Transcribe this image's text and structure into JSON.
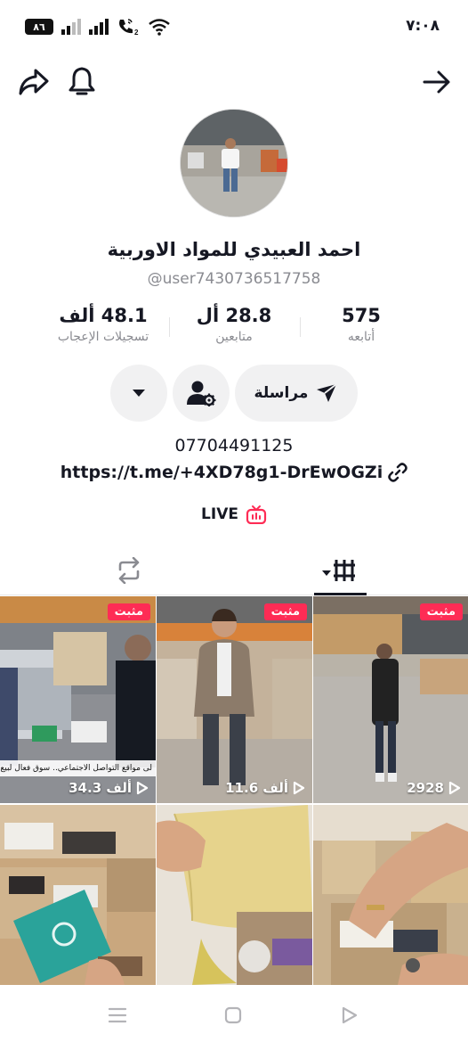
{
  "status_bar": {
    "battery": "٨٦",
    "time": "٧:٠٨",
    "sim_badge": "2"
  },
  "nav": {
    "share_icon": "share-icon",
    "bell_icon": "bell-icon",
    "back_icon": "arrow-right-icon"
  },
  "profile": {
    "display_name": "احمد العبيدي للمواد الاوربية",
    "username": "@user7430736517758",
    "phone": "07704491125",
    "link": "https://t.me/+4XD78g1-DrEwOGZi",
    "live_label": "LIVE"
  },
  "stats": [
    {
      "value": "575",
      "label": "أتابعه"
    },
    {
      "value": "28.8 أل",
      "label": "متابعين"
    },
    {
      "value": "48.1 ألف",
      "label": "تسجيلات الإعجاب"
    }
  ],
  "buttons": {
    "message_label": "مراسلة"
  },
  "videos": [
    {
      "pinned": "مثبت",
      "views": "34.3 ألف",
      "caption": "لى مواقع التواصل الاجتماعي.. سوق فعال لبيع البضائع ال"
    },
    {
      "pinned": "مثبت",
      "views": "11.6 ألف"
    },
    {
      "pinned": "مثبت",
      "views": "2928"
    },
    {},
    {},
    {}
  ],
  "colors": {
    "accent": "#fe2c55",
    "text": "#161823",
    "muted": "#8a8b91",
    "pill_bg": "#f1f1f2"
  }
}
